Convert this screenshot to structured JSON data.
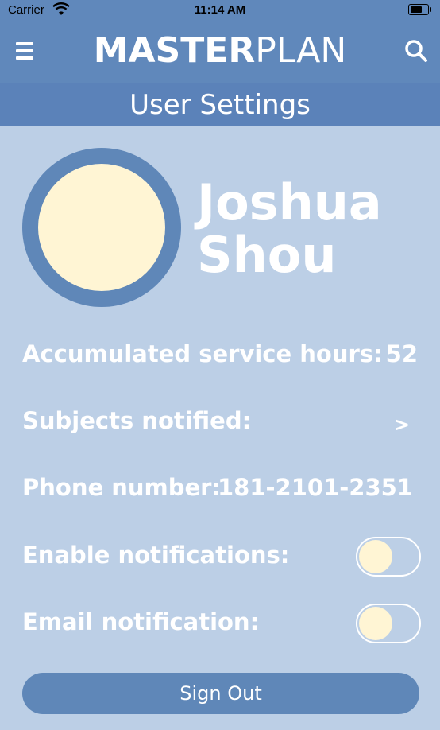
{
  "status_bar": {
    "carrier": "Carrier",
    "time": "11:14 AM"
  },
  "nav": {
    "brand_bold": "MASTER",
    "brand_light": "PLAN"
  },
  "page": {
    "title": "User Settings"
  },
  "user": {
    "first_name": "Joshua",
    "last_name": "Shou"
  },
  "settings": {
    "service_hours_label": "Accumulated service hours:",
    "service_hours_value": "52",
    "subjects_label": "Subjects notified:",
    "subjects_arrow": ">",
    "phone_label": "Phone number:",
    "phone_value": "181-2101-2351",
    "enable_notifications_label": "Enable notifications:",
    "enable_notifications_on": false,
    "email_notification_label": "Email notification:",
    "email_notification_on": false
  },
  "actions": {
    "sign_out_label": "Sign Out"
  },
  "colors": {
    "nav": "#6088bb",
    "title_bar": "#5b82b9",
    "background": "#bccfe6",
    "avatar_ring": "#5f87b8",
    "accent_cream": "#fff5d4"
  },
  "icons": {
    "menu": "hamburger-menu-icon",
    "search": "search-icon",
    "wifi": "wifi-icon",
    "battery": "battery-icon"
  }
}
